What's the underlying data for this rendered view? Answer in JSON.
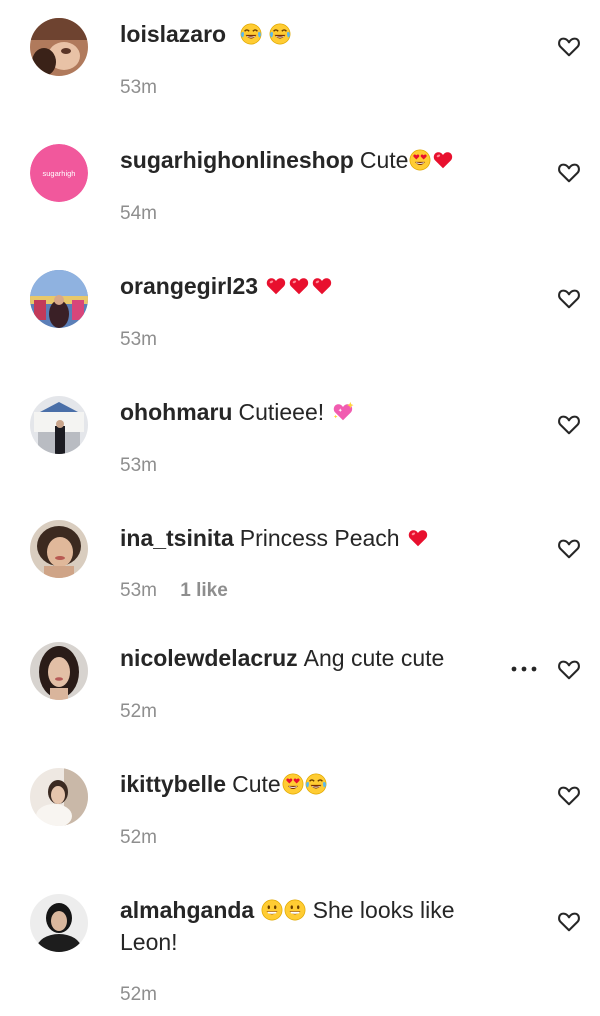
{
  "comments": [
    {
      "username": "loislazaro",
      "text": "",
      "emojis": [
        "joy-emoji",
        "joy-emoji"
      ],
      "time": "53m",
      "likes": ""
    },
    {
      "username": "sugarhighonlineshop",
      "text": "Cute",
      "emojis": [
        "heart-eyes-emoji",
        "red-heart-emoji"
      ],
      "time": "54m",
      "likes": "",
      "avatar_text": "sugarhigh"
    },
    {
      "username": "orangegirl23",
      "text": "",
      "emojis": [
        "red-heart-emoji",
        "red-heart-emoji",
        "red-heart-emoji"
      ],
      "time": "53m",
      "likes": ""
    },
    {
      "username": "ohohmaru",
      "text": "Cutieee!",
      "emojis": [
        "sparkling-heart-emoji"
      ],
      "time": "53m",
      "likes": ""
    },
    {
      "username": "ina_tsinita",
      "text": "Princess Peach",
      "emojis": [
        "red-heart-emoji"
      ],
      "time": "53m",
      "likes": "1 like"
    },
    {
      "username": "nicolewdelacruz",
      "text": "Ang cute cute",
      "emojis": [],
      "time": "52m",
      "likes": ""
    },
    {
      "username": "ikittybelle",
      "text": "Cute",
      "emojis": [
        "heart-eyes-emoji",
        "joy-emoji"
      ],
      "time": "52m",
      "likes": ""
    },
    {
      "username": "almahganda",
      "text": "",
      "emojis": [
        "grin-emoji",
        "grin-emoji"
      ],
      "text_after": "She looks like Leon!",
      "time": "52m",
      "likes": ""
    }
  ],
  "colors": {
    "text": "#262626",
    "meta": "#8e8e8e",
    "heart_red": "#e8102e",
    "brand_pink": "#f1589c"
  },
  "icons": {
    "like": "heart-outline-icon",
    "more": "more-options-icon"
  }
}
